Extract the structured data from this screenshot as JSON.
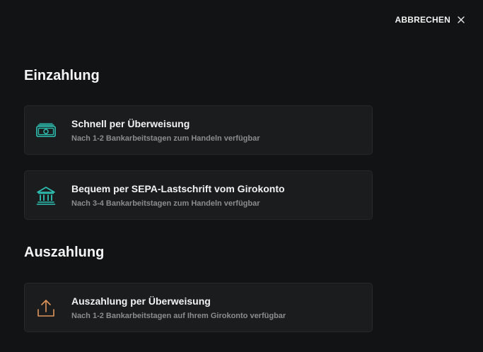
{
  "header": {
    "cancel_label": "ABBRECHEN",
    "cancel_icon": "close-icon"
  },
  "deposit": {
    "title": "Einzahlung",
    "options": [
      {
        "title": "Schnell per Überweisung",
        "subtitle": "Nach 1-2 Bankarbeitstagen zum Handeln verfügbar",
        "icon": "banknote-icon"
      },
      {
        "title": "Bequem per SEPA-Lastschrift vom Girokonto",
        "subtitle": "Nach 3-4 Bankarbeitstagen zum Handeln verfügbar",
        "icon": "bank-building-icon"
      }
    ]
  },
  "withdrawal": {
    "title": "Auszahlung",
    "options": [
      {
        "title": "Auszahlung per Überweisung",
        "subtitle": "Nach 1-2 Bankarbeitstagen auf Ihrem Girokonto verfügbar",
        "icon": "upload-icon"
      }
    ]
  },
  "colors": {
    "background": "#121314",
    "card": "#1b1c1e",
    "deposit_accent": "#2ec4b6",
    "withdrawal_accent": "#e0955a"
  }
}
